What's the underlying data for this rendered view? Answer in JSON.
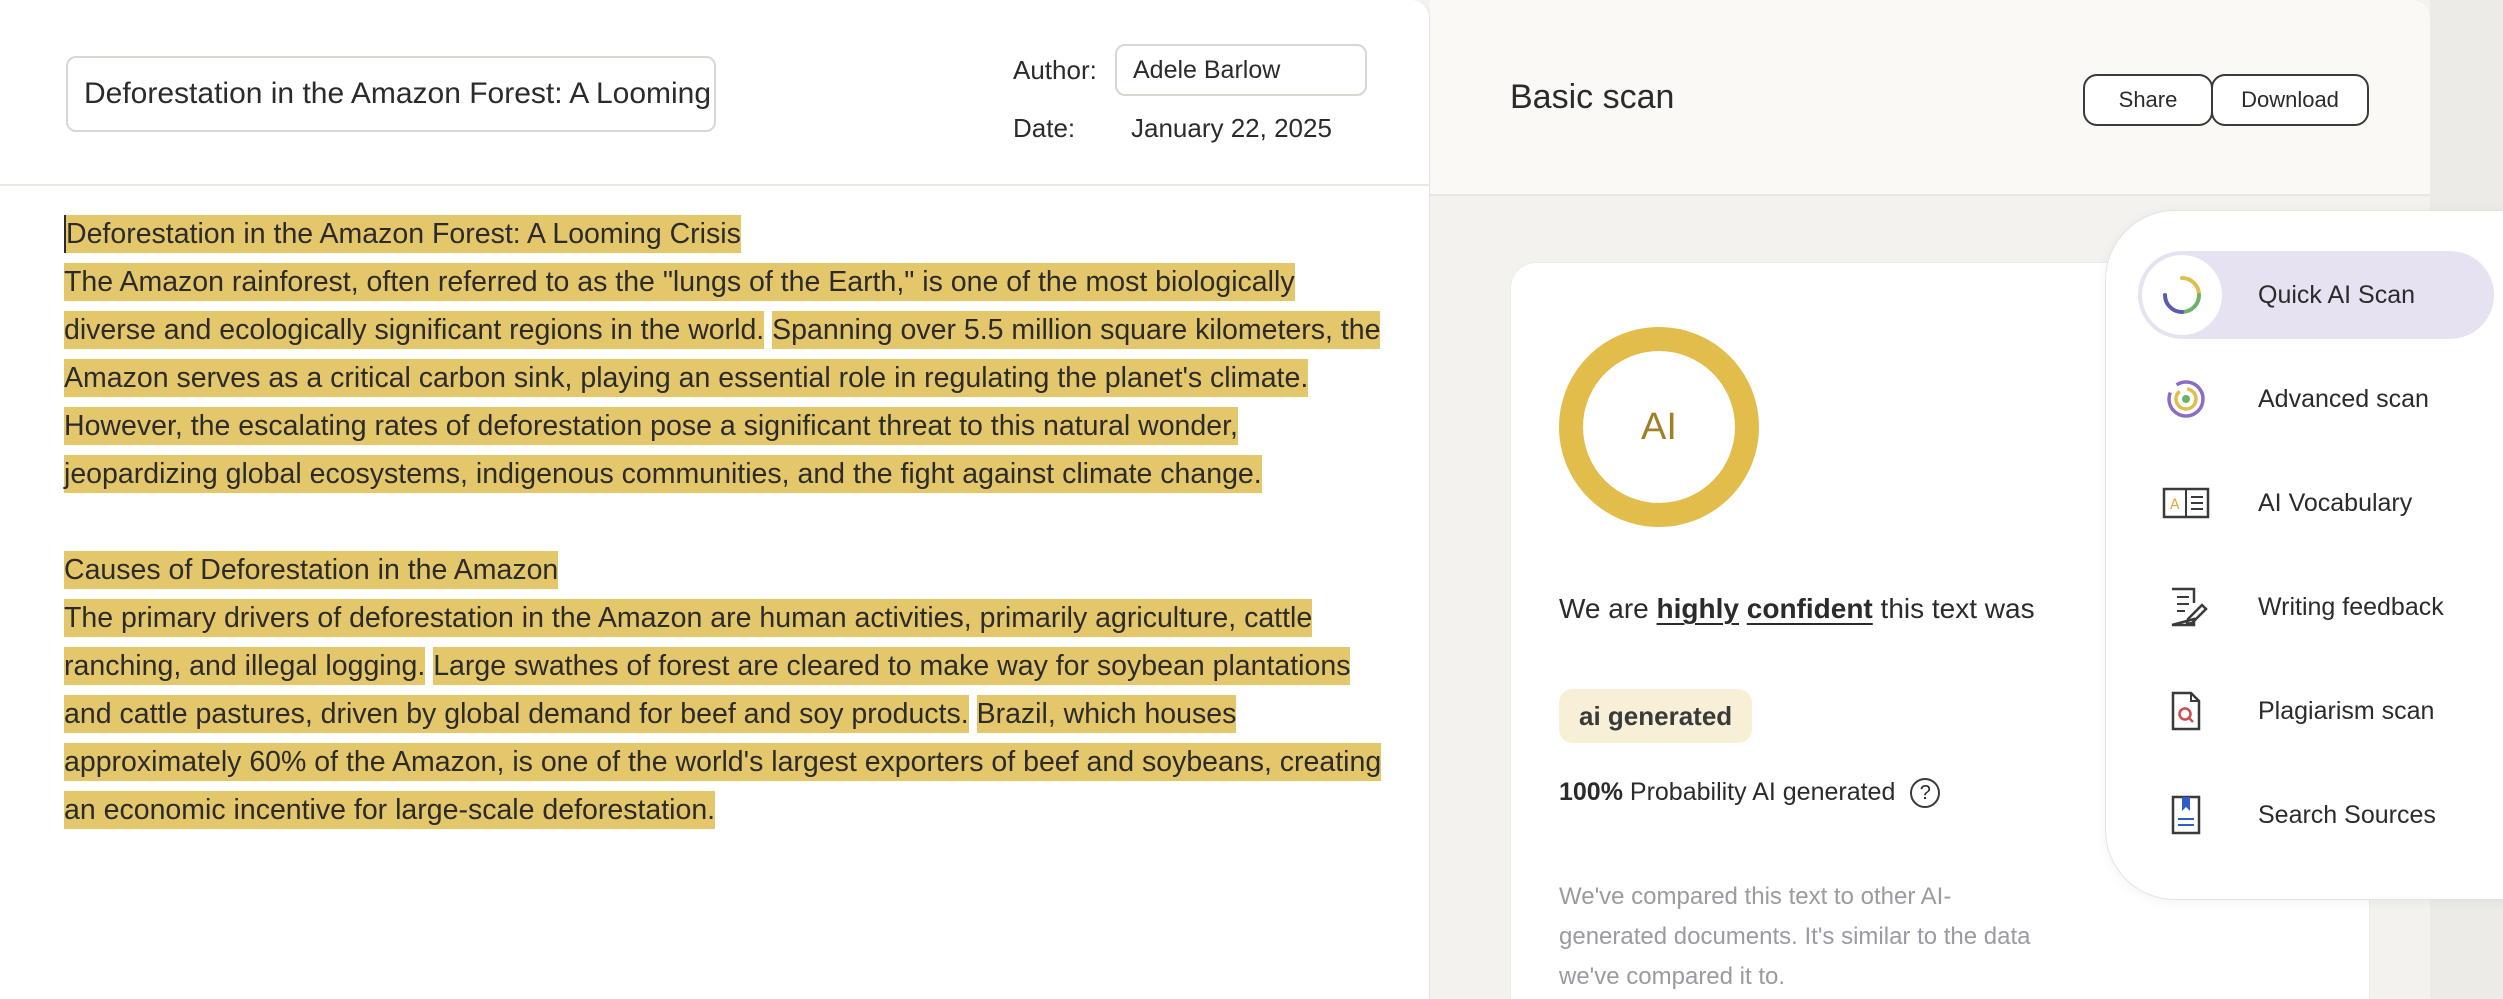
{
  "editor": {
    "title_value": "Deforestation in the Amazon Forest: A Looming Crisis",
    "author_label": "Author:",
    "author_value": "Adele Barlow",
    "date_label": "Date:",
    "date_value": "January 22, 2025"
  },
  "document": {
    "heading1": "Deforestation in the Amazon Forest: A Looming Crisis",
    "p1_s1": "The Amazon rainforest, often referred to as the \"lungs of the Earth,\" is one of the most biologically diverse and ecologically significant regions in the world.",
    "p1_s2": "Spanning over 5.5 million square kilometers, the Amazon serves as a critical carbon sink, playing an essential role in regulating the planet's climate.",
    "p1_s3": "However, the escalating rates of deforestation pose a significant threat to this natural wonder, jeopardizing global ecosystems, indigenous communities, and the fight against climate change.",
    "heading2": "Causes of Deforestation in the Amazon",
    "p2_s1": "The primary drivers of deforestation in the Amazon are human activities, primarily agriculture, cattle ranching, and illegal logging.",
    "p2_s2": "Large swathes of forest are cleared to make way for soybean plantations and cattle pastures, driven by global demand for beef and soy products.",
    "p2_s3": "Brazil, which houses approximately 60% of the Amazon, is one of the world's largest exporters of beef and soybeans, creating an economic incentive for large-scale deforestation."
  },
  "scan": {
    "title": "Basic scan",
    "share_label": "Share",
    "download_label": "Download",
    "ring_label": "AI",
    "ring_color": "#e2bd4c",
    "ai_probability": 1.0,
    "verdict_prefix": "We are",
    "verdict_word1": "highly",
    "verdict_word2": "confident",
    "verdict_suffix": "this text was",
    "badge": "ai generated",
    "probability_value": "100%",
    "probability_text": "Probability AI generated",
    "help_glyph": "?",
    "compare_note": "We've compared this text to other AI-generated documents. It's similar to the data we've compared it to."
  },
  "tools": [
    {
      "label": "Quick AI Scan",
      "icon": "quick-scan-icon",
      "active": true
    },
    {
      "label": "Advanced scan",
      "icon": "advanced-scan-icon",
      "active": false
    },
    {
      "label": "AI Vocabulary",
      "icon": "ai-vocabulary-icon",
      "active": false
    },
    {
      "label": "Writing feedback",
      "icon": "writing-feedback-icon",
      "active": false
    },
    {
      "label": "Plagiarism scan",
      "icon": "plagiarism-scan-icon",
      "active": false
    },
    {
      "label": "Search Sources",
      "icon": "search-sources-icon",
      "active": false
    }
  ],
  "colors": {
    "highlight": "#e5c76b",
    "active_tool": "#e6e2f2",
    "badge_bg": "#f7efd6"
  }
}
